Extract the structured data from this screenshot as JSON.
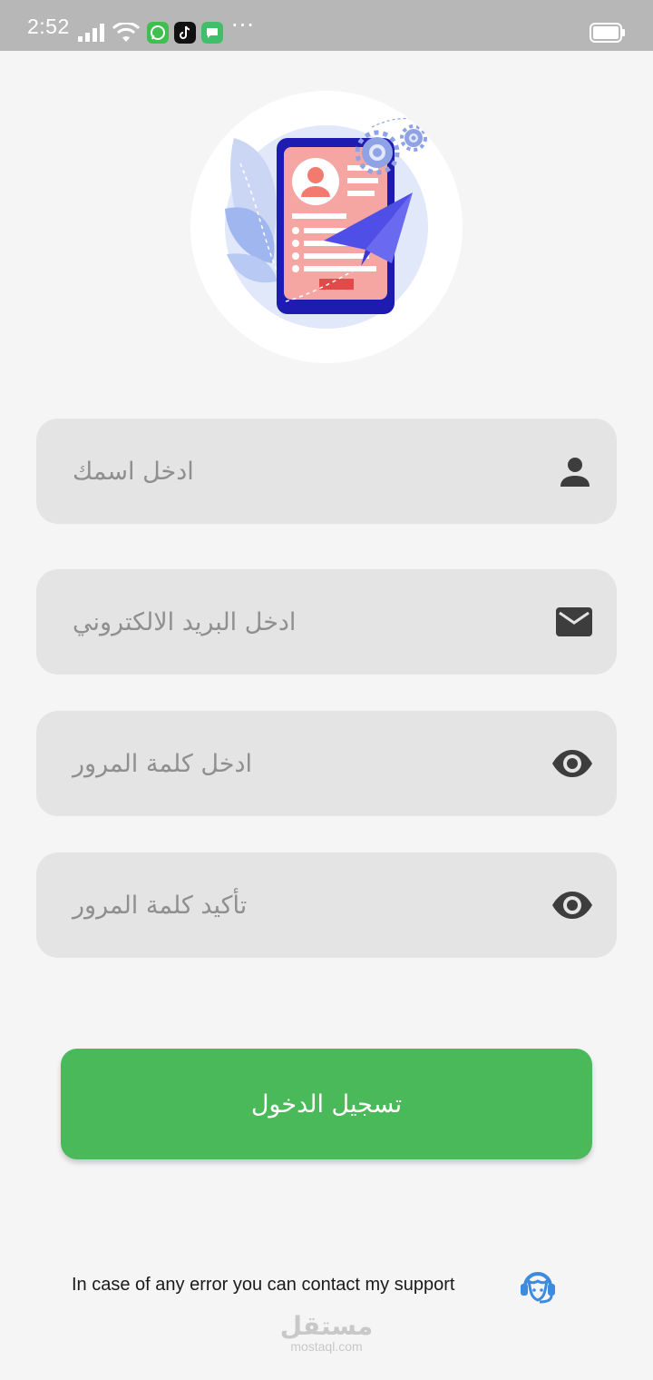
{
  "status_bar": {
    "time": "2:52",
    "apps": [
      "whatsapp-icon",
      "tiktok-icon",
      "messages-icon"
    ],
    "more": "···"
  },
  "form": {
    "name_placeholder": "ادخل اسمك",
    "email_placeholder": "ادخل البريد الالكتروني",
    "password_placeholder": "ادخل كلمة المرور",
    "confirm_password_placeholder": "تأكيد كلمة المرور"
  },
  "login_button": {
    "label": "تسجيل الدخول"
  },
  "support": {
    "text": "In case of any error you can contact my support"
  },
  "watermark": {
    "main": "مستقل",
    "sub": "mostaql.com"
  },
  "colors": {
    "background": "#f5f5f6",
    "field": "#e4e4e5",
    "accent_green": "#4ab95a",
    "support_blue": "#3d8be0",
    "icon_dark": "#3d3d3d"
  }
}
